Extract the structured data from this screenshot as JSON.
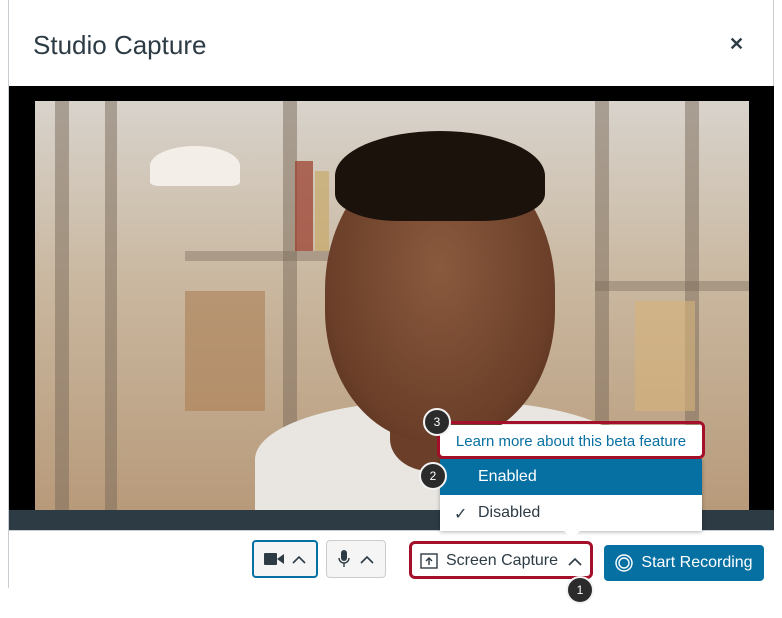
{
  "modal": {
    "title": "Studio Capture",
    "close_icon": "close-icon"
  },
  "controls": {
    "camera_icon": "video-camera-icon",
    "camera_chevron": "chevron-up-icon",
    "mic_icon": "microphone-icon",
    "mic_chevron": "chevron-up-icon",
    "screen_capture_label": "Screen Capture",
    "screen_capture_icon": "screen-share-icon",
    "start_recording_label": "Start Recording",
    "record_icon": "record-icon"
  },
  "screen_menu": {
    "learn_more": "Learn more about this beta feature",
    "options": [
      {
        "label": "Enabled",
        "selected": false
      },
      {
        "label": "Disabled",
        "selected": true
      }
    ]
  },
  "callouts": {
    "one": "1",
    "two": "2",
    "three": "3"
  },
  "colors": {
    "primary": "#0770a3",
    "callout": "#a4102a",
    "text": "#2d3b45"
  }
}
